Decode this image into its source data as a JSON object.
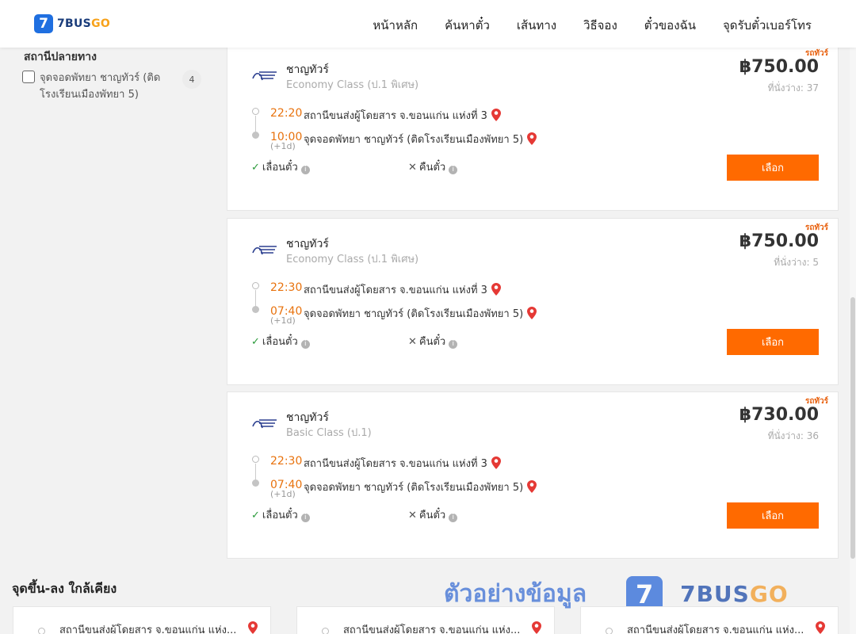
{
  "brand": {
    "logo_mark": "7",
    "name_prefix": "7BUS",
    "name_suffix": "GO"
  },
  "nav": [
    "หน้าหลัก",
    "ค้นหาตั๋ว",
    "เส้นทาง",
    "วิธีจอง",
    "ตั๋วของฉัน",
    "จุดรับตั๋วเบอร์โทร"
  ],
  "filter": {
    "title": "สถานีปลายทาง",
    "items": [
      {
        "label": "จุดจอดพัทยา ชาญทัวร์ (ติดโรงเรียนเมืองพัทยา 5)",
        "count": "4",
        "checked": false
      }
    ]
  },
  "trips": [
    {
      "bus_type": "รถทัวร์",
      "operator": "ชาญทัวร์",
      "bus_class": "Economy Class (ป.1 พิเศษ)",
      "price": "฿750.00",
      "seats": "ที่นั่งว่าง: 37",
      "depart_time": "22:20",
      "depart_station": "สถานีขนส่งผู้โดยสาร จ.ขอนแก่น แห่งที่ 3",
      "arrive_time": "10:00",
      "arrive_station": "จุดจอดพัทยา ชาญทัวร์ (ติดโรงเรียนเมืองพัทยา 5)",
      "next_day": "(+1d)",
      "reschedule": "เลื่อนตั๋ว",
      "refund": "คืนตั๋ว",
      "select": "เลือก"
    },
    {
      "bus_type": "รถทัวร์",
      "operator": "ชาญทัวร์",
      "bus_class": "Economy Class (ป.1 พิเศษ)",
      "price": "฿750.00",
      "seats": "ที่นั่งว่าง: 5",
      "depart_time": "22:30",
      "depart_station": "สถานีขนส่งผู้โดยสาร จ.ขอนแก่น แห่งที่ 3",
      "arrive_time": "07:40",
      "arrive_station": "จุดจอดพัทยา ชาญทัวร์ (ติดโรงเรียนเมืองพัทยา 5)",
      "next_day": "(+1d)",
      "reschedule": "เลื่อนตั๋ว",
      "refund": "คืนตั๋ว",
      "select": "เลือก"
    },
    {
      "bus_type": "รถทัวร์",
      "operator": "ชาญทัวร์",
      "bus_class": "Basic Class (ป.1)",
      "price": "฿730.00",
      "seats": "ที่นั่งว่าง: 36",
      "depart_time": "22:30",
      "depart_station": "สถานีขนส่งผู้โดยสาร จ.ขอนแก่น แห่งที่ 3",
      "arrive_time": "07:40",
      "arrive_station": "จุดจอดพัทยา ชาญทัวร์ (ติดโรงเรียนเมืองพัทยา 5)",
      "next_day": "(+1d)",
      "reschedule": "เลื่อนตั๋ว",
      "refund": "คืนตั๋ว",
      "select": "เลือก"
    }
  ],
  "nearby": {
    "title": "จุดขึ้น-ลง ใกล้เคียง",
    "items": [
      "สถานีขนส่งผู้โดยสาร จ.ขอนแก่น แห่ง...",
      "สถานีขนส่งผู้โดยสาร จ.ขอนแก่น แห่ง...",
      "สถานีขนส่งผู้โดยสาร จ.ขอนแก่น แห่ง..."
    ]
  },
  "watermark": {
    "text": "ตัวอย่างข้อมูล",
    "mark": "7",
    "brand_prefix": "7BUS",
    "brand_suffix": "GO"
  },
  "colors": {
    "accent": "#ff6a00",
    "time": "#e8720d",
    "brand_blue": "#1f6fe0",
    "pin": "#e53935"
  },
  "icons": {
    "pin": "map-pin-icon",
    "check": "check-icon",
    "cross": "cross-icon",
    "info": "info-icon"
  }
}
